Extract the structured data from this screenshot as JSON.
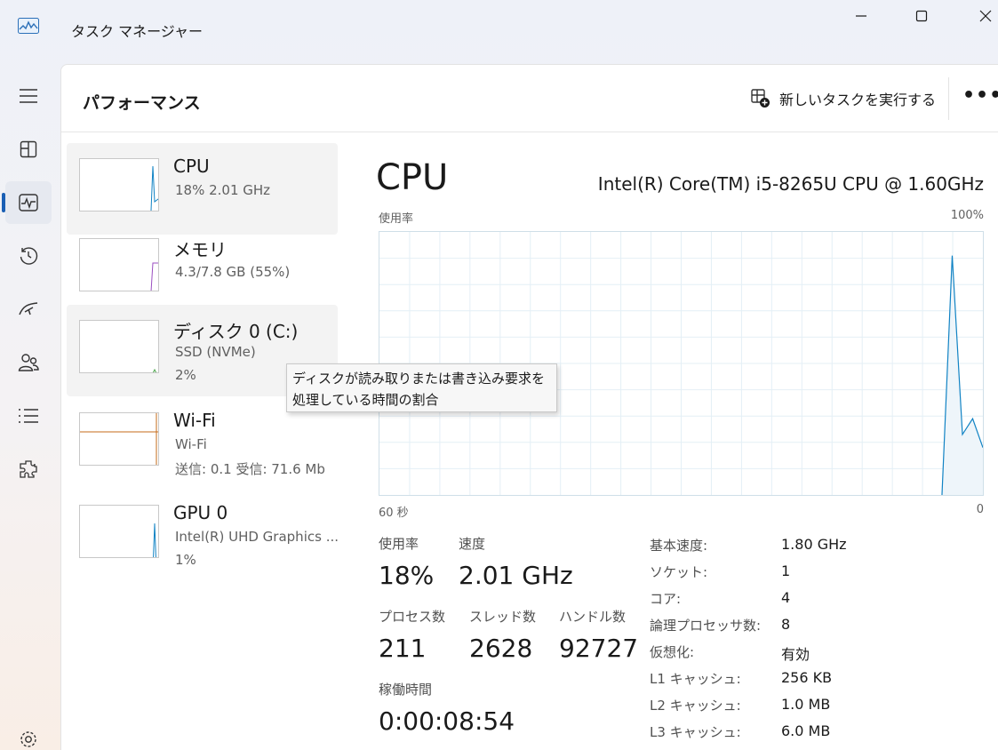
{
  "app": {
    "title": "タスク マネージャー"
  },
  "header": {
    "title": "パフォーマンス",
    "new_task_label": "新しいタスクを実行する",
    "more_label": "•••"
  },
  "devices": [
    {
      "name": "CPU",
      "sub1": "18%  2.01 GHz",
      "sub2": ""
    },
    {
      "name": "メモリ",
      "sub1": "4.3/7.8 GB (55%)",
      "sub2": ""
    },
    {
      "name": "ディスク 0 (C:)",
      "sub1": "SSD (NVMe)",
      "sub2": "2%"
    },
    {
      "name": "Wi-Fi",
      "sub1": "Wi-Fi",
      "sub2": "送信: 0.1  受信: 71.6 Mb"
    },
    {
      "name": "GPU 0",
      "sub1": "Intel(R) UHD Graphics ...",
      "sub2": "1%"
    }
  ],
  "detail": {
    "title": "CPU",
    "model": "Intel(R) Core(TM) i5-8265U CPU @ 1.60GHz",
    "graph_label_left": "使用率",
    "graph_label_right": "100%",
    "axis_left": "60 秒",
    "axis_right": "0",
    "stats": {
      "usage_label": "使用率",
      "usage_value": "18%",
      "speed_label": "速度",
      "speed_value": "2.01 GHz",
      "processes_label": "プロセス数",
      "processes_value": "211",
      "threads_label": "スレッド数",
      "threads_value": "2628",
      "handles_label": "ハンドル数",
      "handles_value": "92727",
      "uptime_label": "稼働時間",
      "uptime_value": "0:00:08:54"
    },
    "specs": [
      {
        "label": "基本速度:",
        "value": "1.80 GHz"
      },
      {
        "label": "ソケット:",
        "value": "1"
      },
      {
        "label": "コア:",
        "value": "4"
      },
      {
        "label": "論理プロセッサ数:",
        "value": "8"
      },
      {
        "label": "仮想化:",
        "value": "有効"
      },
      {
        "label": "L1 キャッシュ:",
        "value": "256 KB"
      },
      {
        "label": "L2 キャッシュ:",
        "value": "1.0 MB"
      },
      {
        "label": "L3 キャッシュ:",
        "value": "6.0 MB"
      }
    ]
  },
  "tooltip": {
    "line1": "ディスクが読み取りまたは書き込み要求を",
    "line2": "処理している時間の割合"
  },
  "cpu_history": {
    "unit": "percent",
    "values": [
      0,
      0,
      0,
      0,
      0,
      0,
      0,
      0,
      0,
      0,
      0,
      0,
      0,
      0,
      0,
      0,
      0,
      0,
      0,
      0,
      0,
      0,
      0,
      0,
      0,
      0,
      0,
      0,
      0,
      0,
      0,
      0,
      0,
      0,
      0,
      0,
      0,
      0,
      0,
      0,
      0,
      0,
      0,
      0,
      0,
      0,
      0,
      0,
      0,
      0,
      0,
      0,
      0,
      0,
      0,
      0,
      91,
      23,
      29,
      18
    ]
  },
  "colors": {
    "cpu_line": "#1183c4",
    "cpu_fill": "#eef5fa",
    "memory_line": "#9b4fc0",
    "wifi_line": "#c46b1a",
    "accent": "#1a5fb4"
  }
}
